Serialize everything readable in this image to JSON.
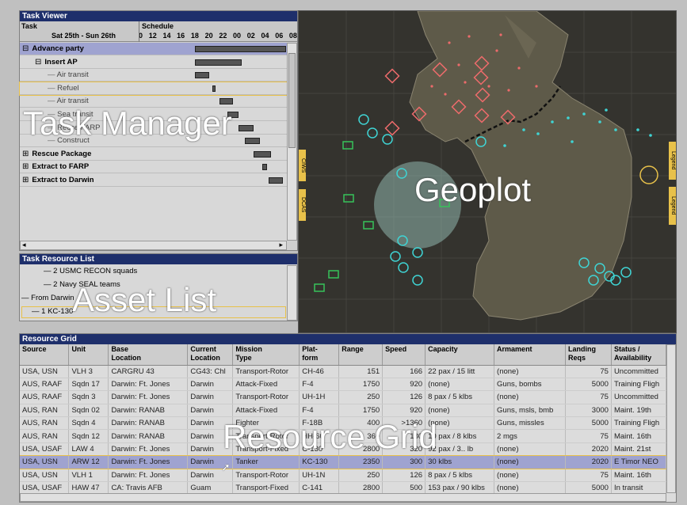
{
  "task_viewer": {
    "title": "Task Viewer",
    "col_task": "Task",
    "col_schedule": "Schedule",
    "date_range": "Sat 25th - Sun 26th",
    "hours": [
      "0",
      "12",
      "14",
      "16",
      "18",
      "20",
      "22",
      "00",
      "02",
      "04",
      "06",
      "08"
    ],
    "rows": [
      {
        "label": "Advance party",
        "expander": "-",
        "bold": true,
        "indent": 0,
        "bar_start": 0.38,
        "bar_len": 0.62,
        "selected": true
      },
      {
        "label": "Insert AP",
        "expander": "-",
        "bold": true,
        "indent": 1,
        "bar_start": 0.38,
        "bar_len": 0.32
      },
      {
        "label": "Air transit",
        "expander": "",
        "bold": false,
        "indent": 2,
        "bar_start": 0.38,
        "bar_len": 0.1
      },
      {
        "label": "Refuel",
        "expander": "",
        "bold": false,
        "indent": 2,
        "bar_start": 0.5,
        "bar_len": 0.02,
        "highlight": true
      },
      {
        "label": "Air transit",
        "expander": "",
        "bold": false,
        "indent": 2,
        "bar_start": 0.55,
        "bar_len": 0.09
      },
      {
        "label": "Sea transit",
        "expander": "",
        "bold": false,
        "indent": 2,
        "bar_start": 0.6,
        "bar_len": 0.08
      },
      {
        "label": "Recce FARP",
        "expander": "",
        "bold": false,
        "indent": 2,
        "bar_start": 0.68,
        "bar_len": 0.1
      },
      {
        "label": "Construct",
        "expander": "",
        "bold": false,
        "indent": 2,
        "bar_start": 0.72,
        "bar_len": 0.1
      },
      {
        "label": "Rescue Package",
        "expander": "+",
        "bold": true,
        "indent": 0,
        "bar_start": 0.78,
        "bar_len": 0.12
      },
      {
        "label": "Extract to FARP",
        "expander": "+",
        "bold": true,
        "indent": 0,
        "bar_start": 0.84,
        "bar_len": 0.03
      },
      {
        "label": "Extract to Darwin",
        "expander": "+",
        "bold": true,
        "indent": 0,
        "bar_start": 0.88,
        "bar_len": 0.1
      }
    ],
    "overlay_label": "Task Manager"
  },
  "resource_list": {
    "title": "Task Resource List",
    "items": [
      "2 USMC RECON squads",
      "2 Navy SEAL teams",
      "From Darwin",
      "1 KC-130"
    ],
    "overlay_label": "Asset List"
  },
  "geoplot": {
    "overlay_label": "Geoplot",
    "left_tabs": [
      "CIWS",
      "DCAS"
    ],
    "right_tabs": [
      "Legend",
      "Legend"
    ]
  },
  "resource_grid": {
    "title": "Resource Grid",
    "overlay_label": "Resource Grid",
    "columns": [
      "Source",
      "Unit",
      "Base\nLocation",
      "Current\nLocation",
      "Mission\nType",
      "Plat-\nform",
      "Range",
      "Speed",
      "Capacity",
      "Armament",
      "Landing\nReqs",
      "Status /\nAvailability"
    ],
    "rows": [
      [
        "USA, USN",
        "VLH 3",
        "CARGRU 43",
        "CG43: Chl",
        "Transport-Rotor",
        "CH-46",
        "151",
        "166",
        "22 pax / 15 litt",
        "(none)",
        "75",
        "Uncommitted"
      ],
      [
        "AUS, RAAF",
        "Sqdn 17",
        "Darwin: Ft. Jones",
        "Darwin",
        "Attack-Fixed",
        "F-4",
        "1750",
        "920",
        "(none)",
        "Guns, bombs",
        "5000",
        "Training Fligh"
      ],
      [
        "AUS, RAAF",
        "Sqdn 3",
        "Darwin: Ft. Jones",
        "Darwin",
        "Transport-Rotor",
        "UH-1H",
        "250",
        "126",
        "8 pax / 5 klbs",
        "(none)",
        "75",
        "Uncommitted"
      ],
      [
        "AUS, RAN",
        "Sqdn 02",
        "Darwin: RANAB",
        "Darwin",
        "Attack-Fixed",
        "F-4",
        "1750",
        "920",
        "(none)",
        "Guns, msls, bmb",
        "3000",
        "Maint. 19th"
      ],
      [
        "AUS, RAN",
        "Sqdn 4",
        "Darwin: RANAB",
        "Darwin",
        "Fighter",
        "F-18B",
        "400",
        "&gt;1360",
        "(none)",
        "Guns, missles",
        "5000",
        "Training Fligh"
      ],
      [
        "AUS, RAN",
        "Sqdn 12",
        "Darwin: RANAB",
        "Darwin",
        "Transport-Rotor",
        "HH-60",
        "360",
        "180",
        "10 pax / 8 klbs",
        "2 mgs",
        "75",
        "Maint. 16th"
      ],
      [
        "USA, USAF",
        "LAW 4",
        "Darwin: Ft. Jones",
        "Darwin",
        "Transport-Fixed",
        "C-130",
        "2800",
        "320",
        "92 pax / 3.. lb",
        "(none)",
        "2020",
        "Maint. 21st"
      ],
      [
        "USA, USN",
        "ARW 12",
        "Darwin: Ft. Jones",
        "Darwin",
        "Tanker",
        "KC-130",
        "2350",
        "300",
        "30 klbs",
        "(none)",
        "2020",
        "E Timor NEO"
      ],
      [
        "USA, USN",
        "VLH 1",
        "Darwin: Ft. Jones",
        "Darwin",
        "Transport-Rotor",
        "UH-1N",
        "250",
        "126",
        "8 pax / 5 klbs",
        "(none)",
        "75",
        "Maint. 16th"
      ],
      [
        "USA, USAF",
        "HAW 47",
        "CA: Travis AFB",
        "Guam",
        "Transport-Fixed",
        "C-141",
        "2800",
        "500",
        "153 pax / 90 klbs",
        "(none)",
        "5000",
        "In transit"
      ]
    ],
    "selected_row": 7
  },
  "colors": {
    "title_bar": "#1e2f6b",
    "selection": "#9fa3d0",
    "highlight": "#e8c14a",
    "map_sea": "#35342f",
    "map_land": "#5f5b4a",
    "enemy": "#ec6b6b",
    "friendly": "#3fd4d4",
    "neutral": "#36c35a"
  }
}
